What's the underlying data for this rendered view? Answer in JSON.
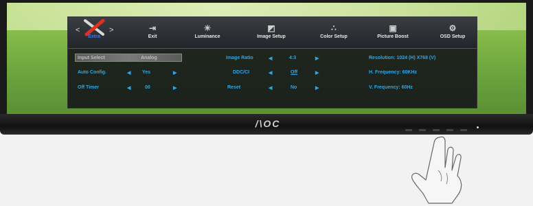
{
  "brand": "/\\OC",
  "osd": {
    "tabs": [
      {
        "label": "Extra",
        "icon": "tools-icon",
        "active": true
      },
      {
        "label": "Exit",
        "icon": "exit-icon"
      },
      {
        "label": "Luminance",
        "icon": "sun-icon"
      },
      {
        "label": "Image Setup",
        "icon": "image-setup-icon"
      },
      {
        "label": "Color Setup",
        "icon": "color-setup-icon"
      },
      {
        "label": "Picture Boost",
        "icon": "picture-boost-icon"
      },
      {
        "label": "OSD Setup",
        "icon": "osd-setup-icon"
      }
    ],
    "left_col": {
      "row1": {
        "label": "Input Select",
        "value": "Analog"
      },
      "row2": {
        "label": "Auto Config.",
        "value": "Yes"
      },
      "row3": {
        "label": "Off Timer",
        "value": "00"
      }
    },
    "mid_col": {
      "row1": {
        "label": "Image Ratio",
        "value": "4:3"
      },
      "row2": {
        "label": "DDC/CI",
        "value": "Off"
      },
      "row3": {
        "label": "Reset",
        "value": "No"
      }
    },
    "info": {
      "resolution": "Resolution: 1024 (H) X768 (V)",
      "h_freq": "H. Frequency: 60KHz",
      "v_freq": "V. Frequency: 60Hz"
    },
    "arrow_left": "<",
    "arrow_right": ">",
    "small_left": "◀",
    "small_right": "▶"
  }
}
